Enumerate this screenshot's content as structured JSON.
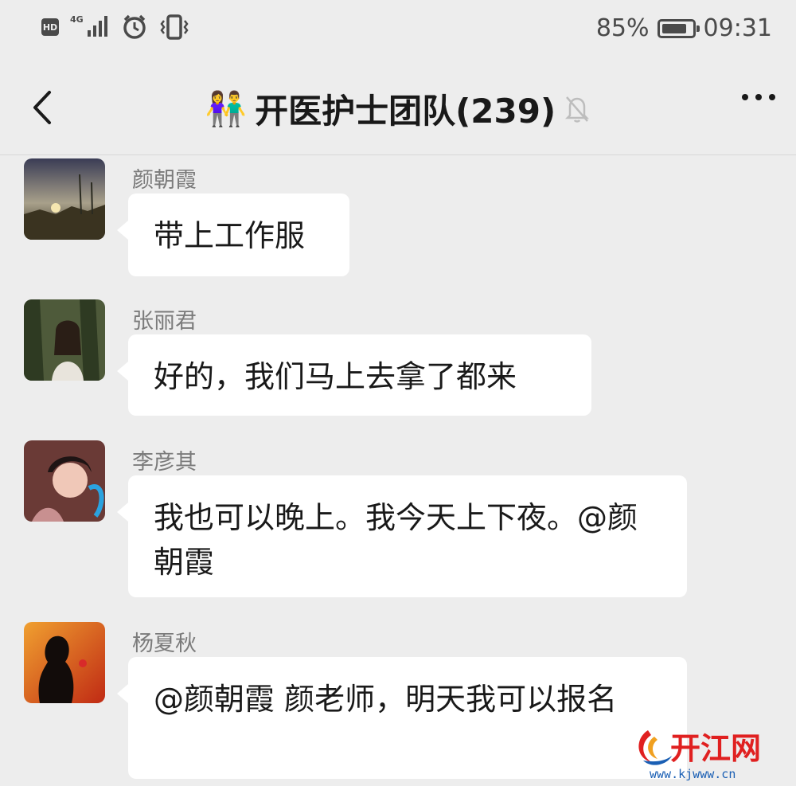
{
  "status_bar": {
    "hd_label": "HD",
    "network_label": "4G",
    "battery": "85%",
    "battery_level": 0.85,
    "time": "09:31"
  },
  "header": {
    "title": "开医护士团队(239)",
    "group_emoji": "👫",
    "back_icon": "chevron-left-icon",
    "mute_icon": "bell-off-icon",
    "more_icon": "more-dots-icon"
  },
  "messages": [
    {
      "sender": "颜朝霞",
      "text": "带上工作服"
    },
    {
      "sender": "张丽君",
      "text": "好的，我们马上去拿了都来"
    },
    {
      "sender": "李彦其",
      "text": "我也可以晚上。我今天上下夜。@颜朝霞"
    },
    {
      "sender": "杨夏秋",
      "text": "@颜朝霞  颜老师，明天我可以报名"
    }
  ],
  "watermark": {
    "logo_text": "开江网",
    "url": "www.kjwww.cn"
  },
  "colors": {
    "background": "#ededed",
    "bubble": "#ffffff",
    "sender_text": "#7b7b7b",
    "watermark_red": "#e02020",
    "watermark_blue": "#1a5fb4"
  }
}
